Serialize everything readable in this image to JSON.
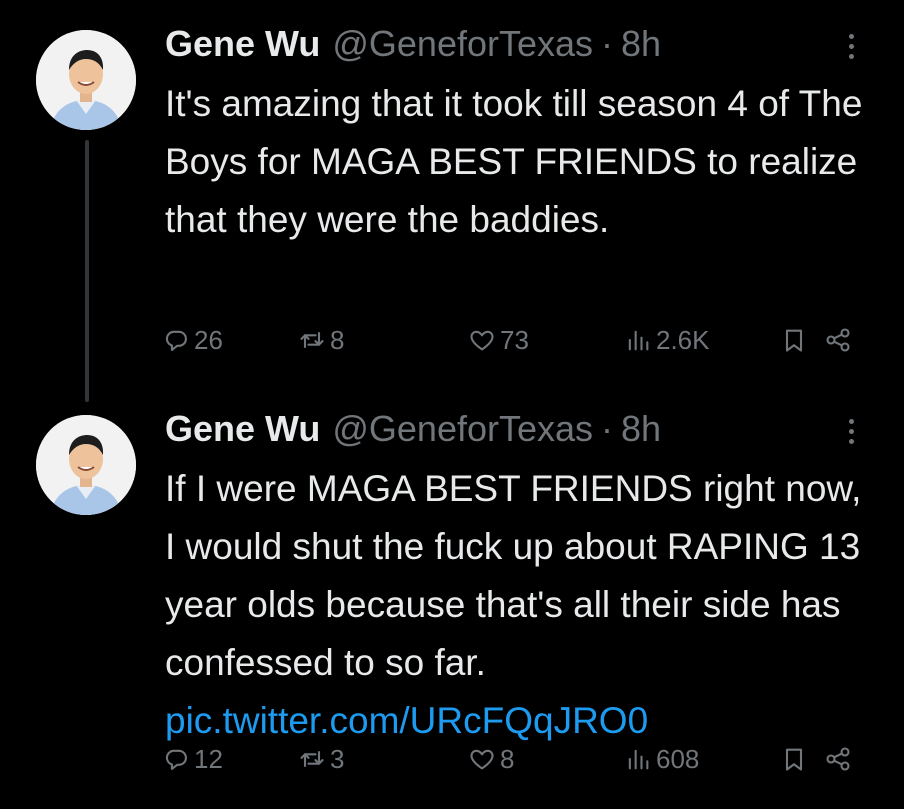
{
  "colors": {
    "background": "#000000",
    "text": "#e7e9ea",
    "secondary": "#71767b",
    "link": "#1d9bf0",
    "thread_line": "#333639"
  },
  "icons": {
    "reply": "reply-icon",
    "retweet": "retweet-icon",
    "like": "heart-icon",
    "views": "views-icon",
    "bookmark": "bookmark-icon",
    "share": "share-icon",
    "more": "more-icon"
  },
  "tweets": [
    {
      "display_name": "Gene Wu",
      "handle": "@GeneforTexas",
      "separator": "·",
      "time": "8h",
      "text": "It's amazing that it took till season 4 of The Boys for MAGA BEST FRIENDS to realize that they were the baddies.",
      "link": "",
      "stats": {
        "replies": "26",
        "retweets": "8",
        "likes": "73",
        "views": "2.6K"
      }
    },
    {
      "display_name": "Gene Wu",
      "handle": "@GeneforTexas",
      "separator": "·",
      "time": "8h",
      "text": "If I were MAGA BEST FRIENDS right now, I would shut the fuck up about RAPING 13 year olds because that's all their side has confessed to so far.",
      "link": "pic.twitter.com/URcFQqJRO0",
      "stats": {
        "replies": "12",
        "retweets": "3",
        "likes": "8",
        "views": "608"
      }
    }
  ]
}
